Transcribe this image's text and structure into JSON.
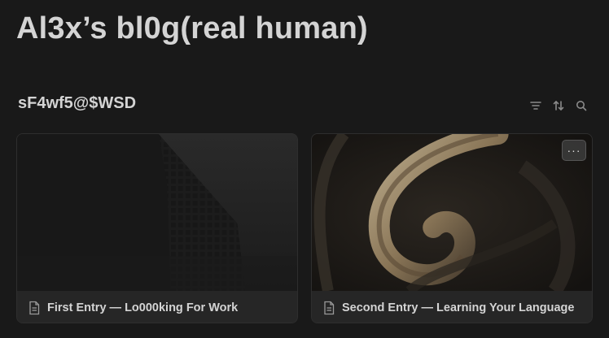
{
  "page": {
    "title": "Al3x’s bl0g(real human)"
  },
  "database": {
    "title": "sF4wf5@$WSD",
    "tools": [
      {
        "icon": "filter-icon"
      },
      {
        "icon": "sort-icon"
      },
      {
        "icon": "search-icon"
      }
    ]
  },
  "cards": [
    {
      "title": "First Entry — Lo000king For Work",
      "icon": "page-icon",
      "cover": "dark-building"
    },
    {
      "title": "Second Entry — Learning Your Language",
      "icon": "page-icon",
      "cover": "golden-swirl",
      "more_label": "···"
    }
  ]
}
